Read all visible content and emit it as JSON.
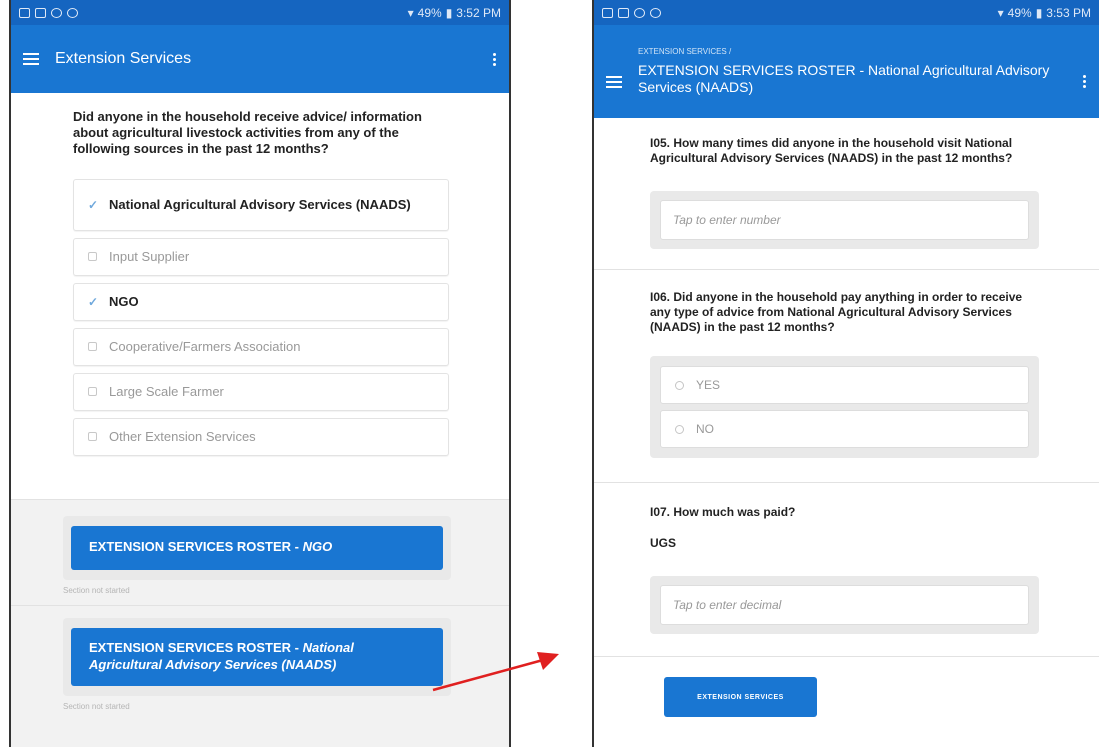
{
  "left": {
    "status": {
      "battery": "49%",
      "time": "3:52 PM"
    },
    "appbar": {
      "title": "Extension Services"
    },
    "question": "Did anyone in the household receive advice/ information about agricultural livestock activities from any of the following sources in the past 12 months?",
    "options": [
      {
        "label": "National Agricultural Advisory Services (NAADS)",
        "checked": true
      },
      {
        "label": "Input Supplier",
        "checked": false
      },
      {
        "label": "NGO",
        "checked": true
      },
      {
        "label": "Cooperative/Farmers Association",
        "checked": false
      },
      {
        "label": "Large Scale Farmer",
        "checked": false
      },
      {
        "label": "Other Extension Services",
        "checked": false
      }
    ],
    "roster1": {
      "prefix": "EXTENSION SERVICES ROSTER - ",
      "italic": "NGO",
      "status": "Section not started"
    },
    "roster2": {
      "prefix": "EXTENSION SERVICES ROSTER - ",
      "italic": "National Agricultural Advisory Services (NAADS)",
      "status": "Section not started"
    }
  },
  "right": {
    "status": {
      "battery": "49%",
      "time": "3:53 PM"
    },
    "appbar": {
      "breadcrumb": "EXTENSION SERVICES /",
      "title": "EXTENSION SERVICES ROSTER - National Agricultural Advisory Services (NAADS)"
    },
    "q05": {
      "text": "I05. How many times did anyone in the household visit National Agricultural Advisory Services (NAADS) in the past 12 months?",
      "placeholder": "Tap to enter number"
    },
    "q06": {
      "text": "I06. Did anyone in the household pay anything in order to receive any type of advice from National Agricultural Advisory Services (NAADS) in the past 12 months?",
      "options": [
        "YES",
        "NO"
      ]
    },
    "q07": {
      "text": "I07. How much was paid?",
      "unit": "UGS",
      "placeholder": "Tap to enter decimal"
    },
    "back_button": "EXTENSION SERVICES"
  },
  "colors": {
    "appbar": "#1976d2",
    "statusbar": "#1565c0",
    "arrow": "#e02020",
    "check": "#6fa8dc"
  }
}
